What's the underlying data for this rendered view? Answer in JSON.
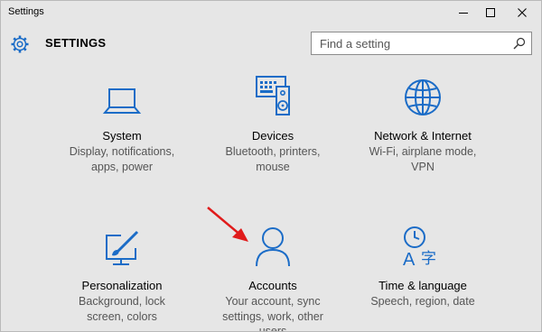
{
  "window": {
    "title": "Settings"
  },
  "header": {
    "title": "SETTINGS"
  },
  "search": {
    "placeholder": "Find a setting"
  },
  "colors": {
    "accent": "#1b6cc7",
    "arrow": "#e01b1b"
  },
  "tiles": [
    {
      "icon": "laptop-icon",
      "title": "System",
      "desc": [
        "Display, notifications,",
        "apps, power"
      ]
    },
    {
      "icon": "keyboard-speaker-icon",
      "title": "Devices",
      "desc": [
        "Bluetooth, printers,",
        "mouse"
      ]
    },
    {
      "icon": "globe-icon",
      "title": "Network & Internet",
      "desc": [
        "Wi-Fi, airplane mode,",
        "VPN"
      ]
    },
    {
      "icon": "paint-brush-icon",
      "title": "Personalization",
      "desc": [
        "Background, lock",
        "screen, colors"
      ]
    },
    {
      "icon": "person-icon",
      "title": "Accounts",
      "desc": [
        "Your account, sync",
        "settings, work, other",
        "users"
      ]
    },
    {
      "icon": "clock-language-icon",
      "title": "Time & language",
      "desc": [
        "Speech, region, date"
      ]
    }
  ]
}
